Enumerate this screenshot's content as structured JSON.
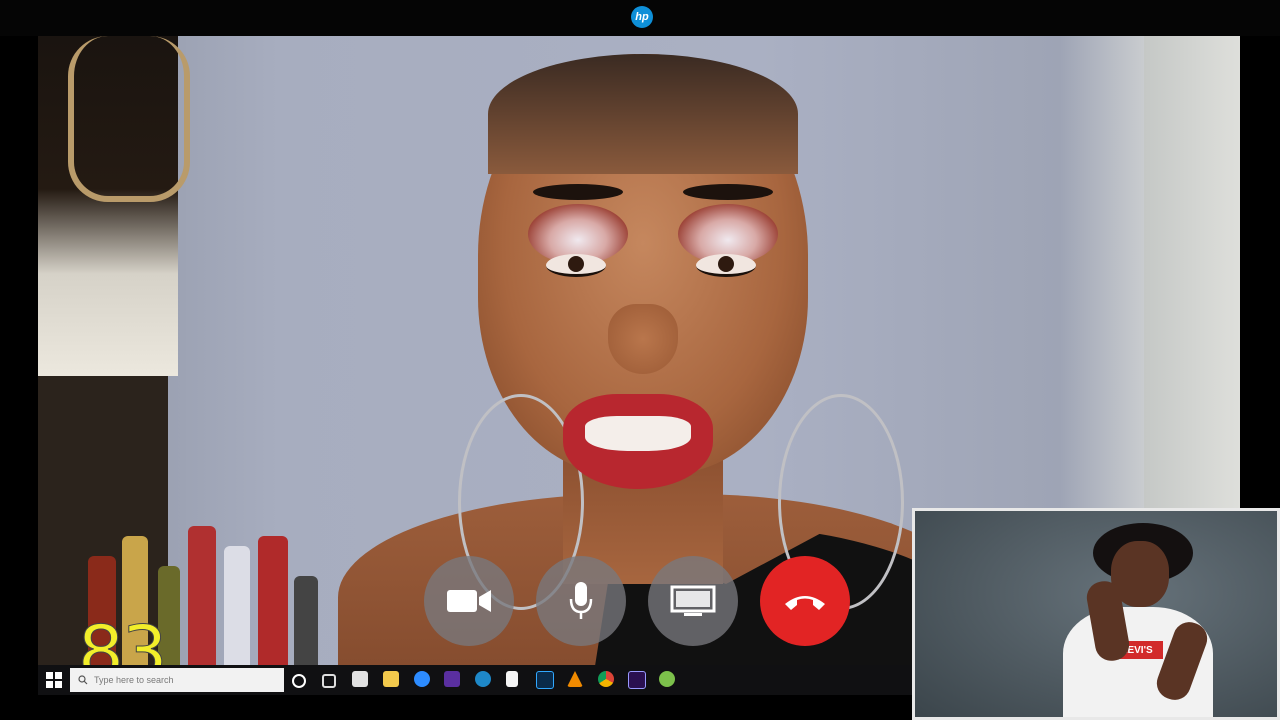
{
  "bezel": {
    "brand_logo": "hp"
  },
  "call": {
    "controls": [
      {
        "name": "camera-button",
        "icon": "video-camera-icon"
      },
      {
        "name": "microphone-button",
        "icon": "microphone-icon"
      },
      {
        "name": "share-screen-button",
        "icon": "screen-share-icon"
      },
      {
        "name": "end-call-button",
        "icon": "hang-up-icon",
        "color": "#e22424"
      }
    ],
    "self_view": {
      "shirt_logo": "LEVI'S"
    }
  },
  "overlay": {
    "counter": "83",
    "color": "#f2ee2a"
  },
  "taskbar": {
    "search_placeholder": "Type here to search",
    "icons": [
      "windows-start-icon",
      "search-icon",
      "cortana-icon",
      "task-view-icon",
      "store-icon",
      "file-explorer-icon",
      "zoom-icon",
      "jw-library-icon",
      "edge-icon",
      "document-icon",
      "photoshop-icon",
      "vlc-icon",
      "chrome-icon",
      "premiere-icon",
      "app-icon"
    ]
  }
}
